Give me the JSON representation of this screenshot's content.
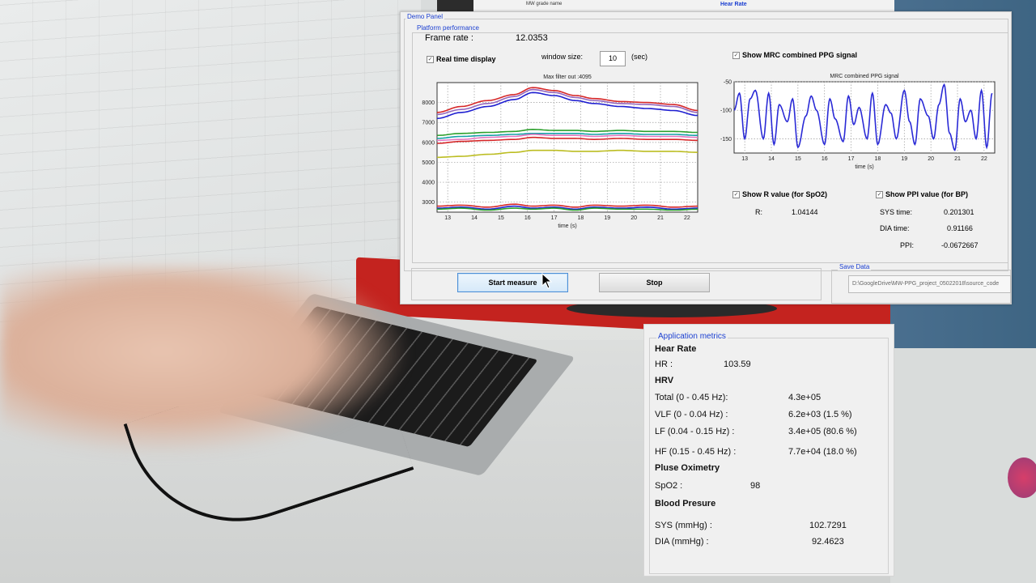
{
  "screen_top": {
    "snippets": [
      "MW grade name",
      "Hear Rate"
    ]
  },
  "demo_panel": {
    "title": "Demo Panel",
    "platform_group_title": "Platform performance",
    "frame_rate_label": "Frame rate :",
    "frame_rate_value": "12.0353",
    "realtime_checkbox_label": "Real time display",
    "window_size_label": "window size:",
    "window_size_value": "10",
    "window_size_unit": "(sec)",
    "show_mrc_label": "Show MRC combined PPG signal",
    "show_r_label": "Show R value (for SpO2)",
    "r_label": "R:",
    "r_value": "1.04144",
    "show_ppi_label": "Show PPI value (for BP)",
    "sys_time_label": "SYS time:",
    "sys_time_value": "0.201301",
    "dia_time_label": "DIA time:",
    "dia_time_value": "0.91166",
    "ppi_label": "PPI:",
    "ppi_value": "-0.0672667",
    "start_button": "Start measure",
    "stop_button": "Stop",
    "save_group_title": "Save Data",
    "save_path": "D:\\GoogleDrive\\MW-PPG_project_05022018\\source_code"
  },
  "chart_data": [
    {
      "type": "line",
      "title": "Max filter out :4095",
      "xlabel": "time (s)",
      "ylabel": "",
      "xlim": [
        12.6,
        22.4
      ],
      "ylim": [
        2500,
        9000
      ],
      "xticks": [
        13,
        14,
        15,
        16,
        17,
        18,
        19,
        20,
        21,
        22
      ],
      "yticks": [
        3000,
        4000,
        5000,
        6000,
        7000,
        8000
      ],
      "grid": true,
      "x": [
        12.6,
        13.5,
        14.5,
        15.5,
        16.2,
        17.0,
        17.8,
        18.5,
        19.5,
        20.5,
        21.5,
        22.4
      ],
      "series": [
        {
          "color": "#d62728",
          "values": [
            7500,
            7800,
            8100,
            8400,
            8750,
            8600,
            8350,
            8200,
            8050,
            8000,
            7900,
            7600
          ]
        },
        {
          "color": "#9467bd",
          "values": [
            7400,
            7650,
            7950,
            8300,
            8650,
            8500,
            8250,
            8100,
            7950,
            7900,
            7800,
            7500
          ]
        },
        {
          "color": "#1f1fd1",
          "values": [
            7200,
            7500,
            7800,
            8150,
            8500,
            8350,
            8100,
            7950,
            7800,
            7700,
            7600,
            7350
          ]
        },
        {
          "color": "#2ca02c",
          "values": [
            6350,
            6450,
            6500,
            6550,
            6650,
            6600,
            6600,
            6550,
            6600,
            6550,
            6550,
            6500
          ]
        },
        {
          "color": "#17a2a8",
          "values": [
            6200,
            6300,
            6350,
            6400,
            6450,
            6450,
            6450,
            6400,
            6450,
            6400,
            6400,
            6350
          ]
        },
        {
          "color": "#e377c2",
          "values": [
            6100,
            6150,
            6250,
            6300,
            6400,
            6350,
            6350,
            6300,
            6350,
            6300,
            6300,
            6250
          ]
        },
        {
          "color": "#d62728",
          "values": [
            5950,
            6050,
            6100,
            6150,
            6250,
            6200,
            6200,
            6150,
            6200,
            6150,
            6150,
            6100
          ]
        },
        {
          "color": "#bcbd22",
          "values": [
            5250,
            5300,
            5400,
            5500,
            5600,
            5600,
            5550,
            5550,
            5600,
            5550,
            5550,
            5500
          ]
        },
        {
          "color": "#d62728",
          "values": [
            2800,
            2850,
            2750,
            2900,
            2800,
            2850,
            2750,
            2850,
            2800,
            2850,
            2750,
            2800
          ]
        },
        {
          "color": "#1f1fd1",
          "values": [
            2700,
            2750,
            2650,
            2800,
            2700,
            2750,
            2650,
            2750,
            2700,
            2750,
            2650,
            2700
          ]
        },
        {
          "color": "#2ca02c",
          "values": [
            2650,
            2700,
            2600,
            2700,
            2650,
            2700,
            2600,
            2700,
            2650,
            2650,
            2600,
            2650
          ]
        }
      ]
    },
    {
      "type": "line",
      "title": "MRC combined PPG signal",
      "xlabel": "time (s)",
      "ylabel": "",
      "xlim": [
        12.6,
        22.4
      ],
      "ylim": [
        -175,
        -50
      ],
      "xticks": [
        13,
        14,
        15,
        16,
        17,
        18,
        19,
        20,
        21,
        22
      ],
      "yticks": [
        -50,
        -100,
        -150
      ],
      "grid": true,
      "series": [
        {
          "color": "#2a2ad6",
          "x": [
            12.6,
            12.8,
            13.0,
            13.2,
            13.4,
            13.7,
            13.9,
            14.1,
            14.3,
            14.6,
            14.8,
            15.0,
            15.3,
            15.5,
            15.7,
            16.0,
            16.2,
            16.4,
            16.7,
            16.9,
            17.1,
            17.3,
            17.6,
            17.8,
            18.0,
            18.3,
            18.5,
            18.7,
            19.0,
            19.2,
            19.4,
            19.6,
            19.9,
            20.1,
            20.3,
            20.5,
            20.7,
            20.9,
            21.1,
            21.3,
            21.5,
            21.7,
            21.9,
            22.1,
            22.3
          ],
          "values": [
            -100,
            -70,
            -150,
            -80,
            -65,
            -150,
            -70,
            -160,
            -90,
            -120,
            -80,
            -165,
            -110,
            -75,
            -100,
            -160,
            -80,
            -115,
            -155,
            -75,
            -125,
            -95,
            -150,
            -70,
            -160,
            -90,
            -105,
            -150,
            -65,
            -120,
            -160,
            -80,
            -110,
            -150,
            -90,
            -55,
            -140,
            -170,
            -80,
            -120,
            -100,
            -150,
            -65,
            -165,
            -70
          ]
        }
      ]
    }
  ],
  "metrics": {
    "title": "Application metrics",
    "heart_rate_heading": "Hear Rate",
    "hr_label": "HR :",
    "hr_value": "103.59",
    "hrv_heading": "HRV",
    "total_label": "Total (0 - 0.45 Hz):",
    "total_value": "4.3e+05",
    "vlf_label": "VLF (0 - 0.04 Hz) :",
    "vlf_value": "6.2e+03 (1.5 %)",
    "lf_label": "LF (0.04 - 0.15 Hz) :",
    "lf_value": "3.4e+05 (80.6 %)",
    "hf_label": "HF (0.15 - 0.45 Hz) :",
    "hf_value": "7.7e+04 (18.0 %)",
    "oximetry_heading": "Pluse Oximetry",
    "spo2_label": "SpO2 :",
    "spo2_value": "98",
    "bp_heading": "Blood Presure",
    "sys_label": "SYS (mmHg) :",
    "sys_value": "102.7291",
    "dia_label": "DIA (mmHg) :",
    "dia_value": "92.4623"
  }
}
